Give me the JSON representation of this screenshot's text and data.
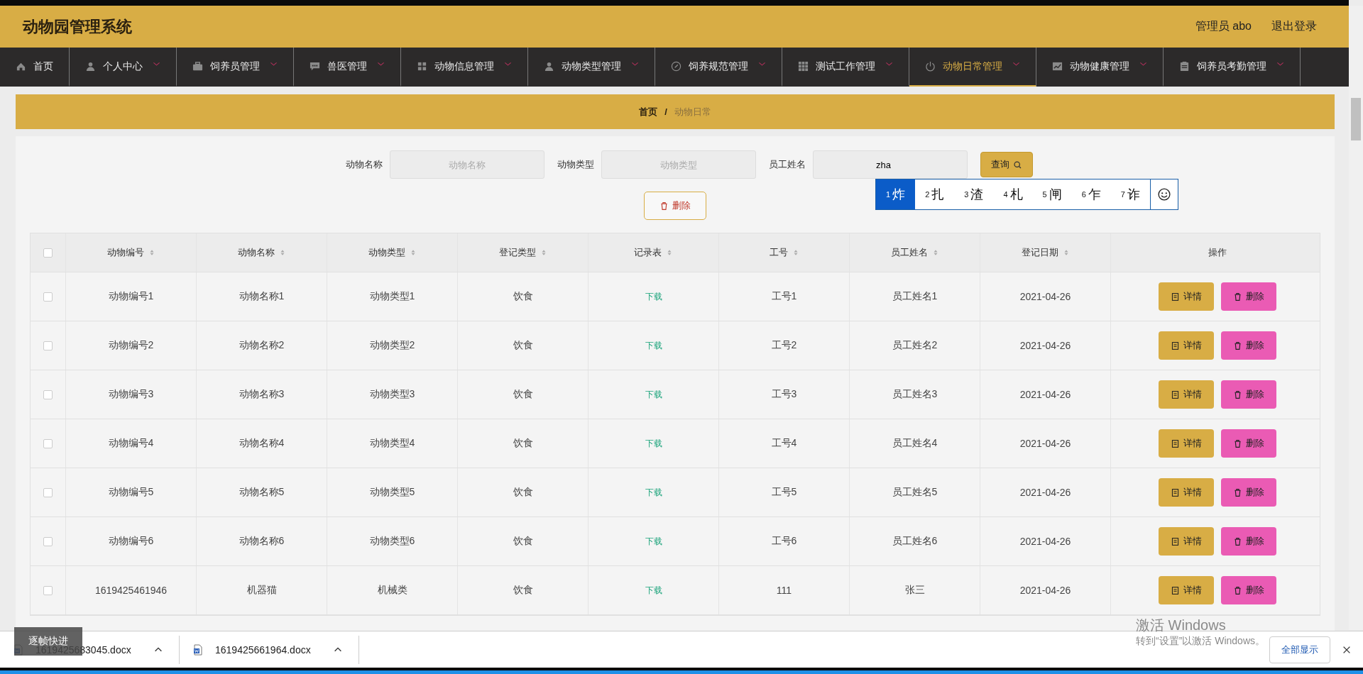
{
  "header": {
    "title": "动物园管理系统",
    "user": "管理员 abo",
    "logout": "退出登录"
  },
  "nav": [
    {
      "label": "首页",
      "kind": "home",
      "dropdown": false,
      "selected": false
    },
    {
      "label": "个人中心",
      "kind": "user",
      "dropdown": true,
      "selected": false
    },
    {
      "label": "饲养员管理",
      "kind": "briefcase",
      "dropdown": true,
      "selected": false
    },
    {
      "label": "兽医管理",
      "kind": "chat",
      "dropdown": true,
      "selected": false
    },
    {
      "label": "动物信息管理",
      "kind": "grid",
      "dropdown": true,
      "selected": false
    },
    {
      "label": "动物类型管理",
      "kind": "user",
      "dropdown": true,
      "selected": false
    },
    {
      "label": "饲养规范管理",
      "kind": "compass",
      "dropdown": true,
      "selected": false
    },
    {
      "label": "测试工作管理",
      "kind": "dots",
      "dropdown": true,
      "selected": false
    },
    {
      "label": "动物日常管理",
      "kind": "power",
      "dropdown": true,
      "selected": true
    },
    {
      "label": "动物健康管理",
      "kind": "chart",
      "dropdown": true,
      "selected": false
    },
    {
      "label": "饲养员考勤管理",
      "kind": "clipboard",
      "dropdown": true,
      "selected": false
    }
  ],
  "breadcrumb": {
    "items": [
      {
        "label": "首页",
        "current": false
      },
      {
        "label": "动物日常",
        "current": true
      }
    ],
    "separator": "/"
  },
  "search": {
    "fields": [
      {
        "label": "动物名称",
        "placeholder": "动物名称"
      },
      {
        "label": "动物类型",
        "placeholder": "动物类型"
      },
      {
        "label": "员工姓名",
        "value": "zha"
      }
    ],
    "button": "查询"
  },
  "ime": {
    "candidates": [
      {
        "index": "1",
        "text": "炸",
        "selected": true
      },
      {
        "index": "2",
        "text": "扎",
        "selected": false
      },
      {
        "index": "3",
        "text": "渣",
        "selected": false
      },
      {
        "index": "4",
        "text": "札",
        "selected": false
      },
      {
        "index": "5",
        "text": "闸",
        "selected": false
      },
      {
        "index": "6",
        "text": "乍",
        "selected": false
      },
      {
        "index": "7",
        "text": "诈",
        "selected": false
      }
    ]
  },
  "delete_button": "删除",
  "table": {
    "select_all": {
      "checked": false
    },
    "columns": [
      {
        "label": "动物编号",
        "sortable": true,
        "kind": "text"
      },
      {
        "label": "动物名称",
        "sortable": true,
        "kind": "text"
      },
      {
        "label": "动物类型",
        "sortable": true,
        "kind": "text"
      },
      {
        "label": "登记类型",
        "sortable": true,
        "kind": "text"
      },
      {
        "label": "记录表",
        "sortable": true,
        "kind": "link"
      },
      {
        "label": "工号",
        "sortable": true,
        "kind": "text"
      },
      {
        "label": "员工姓名",
        "sortable": true,
        "kind": "text"
      },
      {
        "label": "登记日期",
        "sortable": true,
        "kind": "text"
      },
      {
        "label": "操作",
        "sortable": false,
        "kind": "actions"
      }
    ],
    "rows": [
      {
        "checked": false,
        "cells": [
          "动物编号1",
          "动物名称1",
          "动物类型1",
          "饮食",
          "下载",
          "工号1",
          "员工姓名1",
          "2021-04-26"
        ],
        "actions": [
          "详情",
          "删除"
        ]
      },
      {
        "checked": false,
        "cells": [
          "动物编号2",
          "动物名称2",
          "动物类型2",
          "饮食",
          "下载",
          "工号2",
          "员工姓名2",
          "2021-04-26"
        ],
        "actions": [
          "详情",
          "删除"
        ]
      },
      {
        "checked": false,
        "cells": [
          "动物编号3",
          "动物名称3",
          "动物类型3",
          "饮食",
          "下载",
          "工号3",
          "员工姓名3",
          "2021-04-26"
        ],
        "actions": [
          "详情",
          "删除"
        ]
      },
      {
        "checked": false,
        "cells": [
          "动物编号4",
          "动物名称4",
          "动物类型4",
          "饮食",
          "下载",
          "工号4",
          "员工姓名4",
          "2021-04-26"
        ],
        "actions": [
          "详情",
          "删除"
        ]
      },
      {
        "checked": false,
        "cells": [
          "动物编号5",
          "动物名称5",
          "动物类型5",
          "饮食",
          "下载",
          "工号5",
          "员工姓名5",
          "2021-04-26"
        ],
        "actions": [
          "详情",
          "删除"
        ]
      },
      {
        "checked": false,
        "cells": [
          "动物编号6",
          "动物名称6",
          "动物类型6",
          "饮食",
          "下载",
          "工号6",
          "员工姓名6",
          "2021-04-26"
        ],
        "actions": [
          "详情",
          "删除"
        ]
      },
      {
        "checked": false,
        "cells": [
          "1619425461946",
          "机器猫",
          "机械类",
          "饮食",
          "下载",
          "111",
          "张三",
          "2021-04-26"
        ],
        "actions": [
          "详情",
          "删除"
        ]
      }
    ]
  },
  "activation_notice": {
    "title": "激活 Windows",
    "text": "转到“设置”以激活 Windows。"
  },
  "tooltip": "逐帧快进",
  "downloads": {
    "items": [
      "1619425683045.docx",
      "1619425661964.docx"
    ],
    "show_all": "全部显示"
  }
}
